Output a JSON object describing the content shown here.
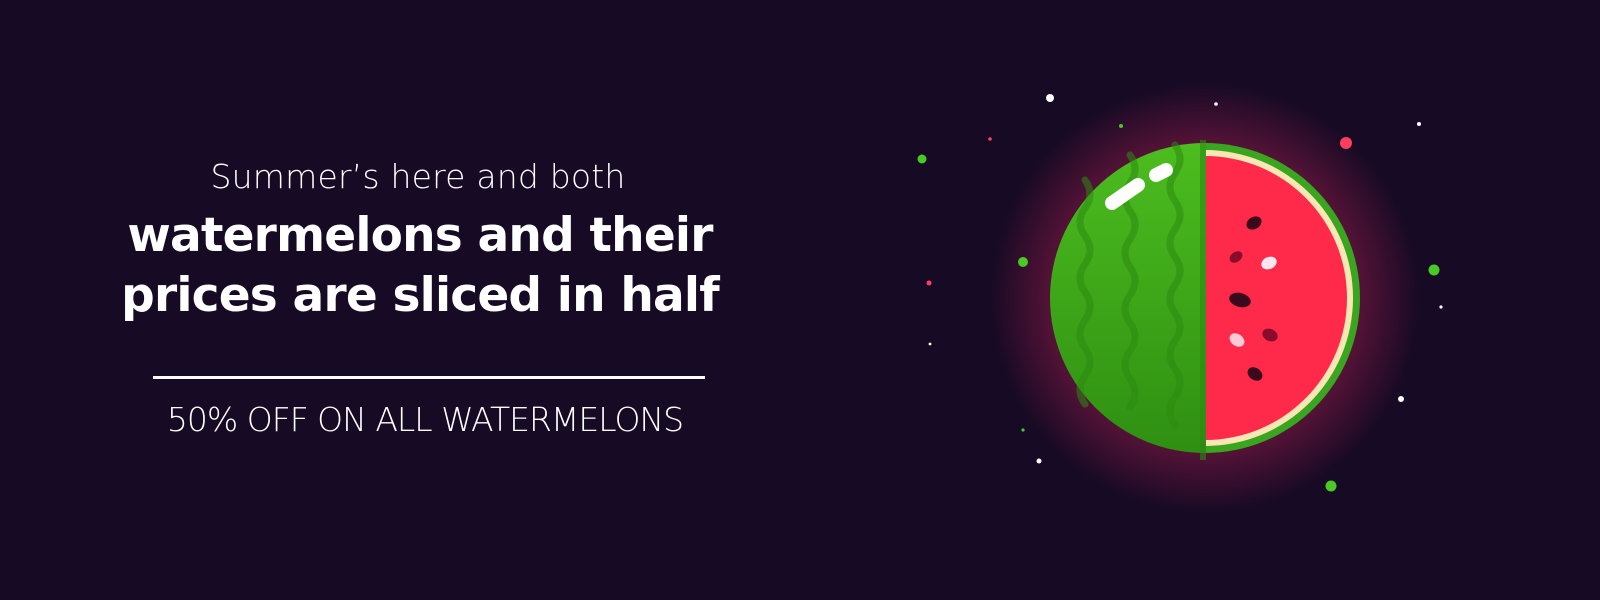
{
  "banner": {
    "intro": "Summer’s here and both",
    "headline_line1": "watermelons and their",
    "headline_line2": "prices are sliced in half",
    "offer": "50% OFF ON ALL WATERMELONS"
  },
  "colors": {
    "background": "#170a24",
    "text": "#ffffff",
    "rind_green": "#3aa51e",
    "rind_highlight": "#55c422",
    "flesh_red": "#ff2a4a",
    "rind_light": "#f8e7b5",
    "seed_dark": "#3a0a1c",
    "seed_light": "#ffe6ee",
    "sparkle_green": "#48c924",
    "sparkle_red": "#ff3d5e",
    "sparkle_white": "#ffffff"
  },
  "icons": {
    "illustration": "watermelon-half-icon",
    "decor": "sparkle-dot-icon"
  }
}
